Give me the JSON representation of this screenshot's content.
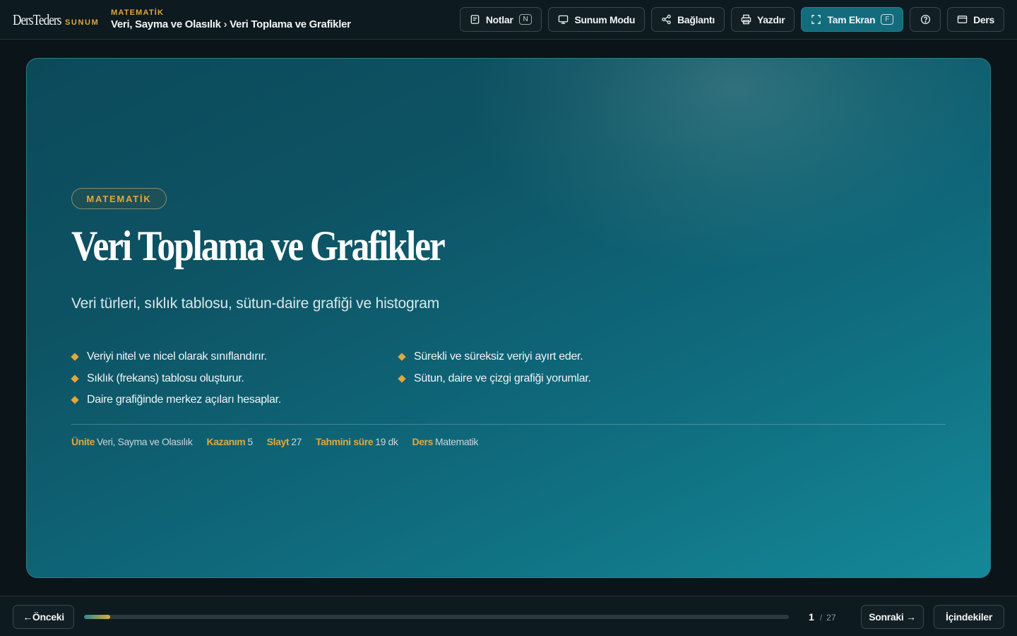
{
  "header": {
    "brand_name": "DersTeders",
    "brand_tag": "SUNUM",
    "kicker": "MATEMATİK",
    "path_unit": "Veri, Sayma ve Olasılık",
    "path_separator": "›",
    "path_lesson": "Veri Toplama ve Grafikler"
  },
  "toolbar": {
    "notes_label": "Notlar",
    "notes_key": "N",
    "present_label": "Sunum Modu",
    "link_label": "Bağlantı",
    "print_label": "Yazdır",
    "fullscreen_label": "Tam Ekran",
    "fullscreen_key": "F",
    "lesson_label": "Ders"
  },
  "slide": {
    "subject": "MATEMATİK",
    "title": "Veri Toplama ve Grafikler",
    "subtitle": "Veri türleri, sıklık tablosu, sütun-daire grafiği ve histogram",
    "goals_left": [
      "Veriyi nitel ve nicel olarak sınıflandırır.",
      "Sıklık (frekans) tablosu oluşturur.",
      "Daire grafiğinde merkez açıları hesaplar."
    ],
    "goals_right": [
      "Sürekli ve süreksiz veriyi ayırt eder.",
      "Sütun, daire ve çizgi grafiği yorumlar."
    ],
    "meta": [
      {
        "key": "Ünite",
        "value": "Veri, Sayma ve Olasılık"
      },
      {
        "key": "Kazanım",
        "value": "5"
      },
      {
        "key": "Slayt",
        "value": "27"
      },
      {
        "key": "Tahmini süre",
        "value": "19 dk"
      },
      {
        "key": "Ders",
        "value": "Matematik"
      }
    ]
  },
  "footer": {
    "prev_label": "←Önceki",
    "next_label": "Sonraki →",
    "toc_label": "İçindekiler",
    "current_page": "1",
    "page_separator": "/",
    "total_pages": "27",
    "progress_fraction": 0.037
  },
  "colors": {
    "accent_gold": "#e0a83e",
    "accent_teal": "#136c7c",
    "slide_bg_start": "#0c4a5a",
    "slide_bg_end": "#148898"
  }
}
